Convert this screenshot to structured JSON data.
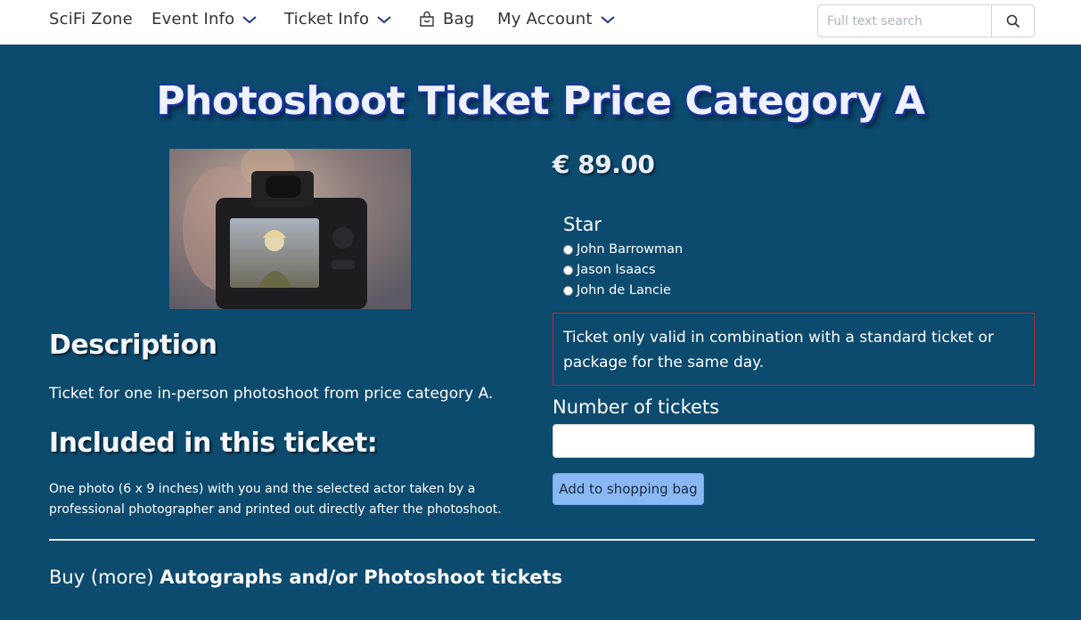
{
  "nav": {
    "brand": "SciFi Zone",
    "event_info": "Event Info",
    "ticket_info": "Ticket Info",
    "bag": "Bag",
    "my_account": "My Account"
  },
  "search": {
    "placeholder": "Full text search"
  },
  "product": {
    "title": "Photoshoot Ticket Price Category A",
    "price": "€ 89.00",
    "description_heading": "Description",
    "description": "Ticket for one in-person photoshoot from price category A.",
    "included_heading": "Included in this ticket:",
    "included_text": "One photo (6 x 9 inches) with you and the selected actor taken by a professional photographer and printed out directly after the photoshoot."
  },
  "star": {
    "label": "Star",
    "options": [
      "John Barrowman",
      "Jason Isaacs",
      "John de Lancie"
    ]
  },
  "notice": "Ticket only valid in combination with a standard ticket or package for the same day.",
  "quantity": {
    "label": "Number of tickets",
    "value": ""
  },
  "actions": {
    "add_to_bag": "Add to shopping bag"
  },
  "more": {
    "prefix": "Buy (more)",
    "link": "Autographs and/or Photoshoot tickets"
  },
  "colors": {
    "background": "#0c4a6e",
    "notice_border": "#c1272d",
    "button": "#8ab8f2"
  }
}
